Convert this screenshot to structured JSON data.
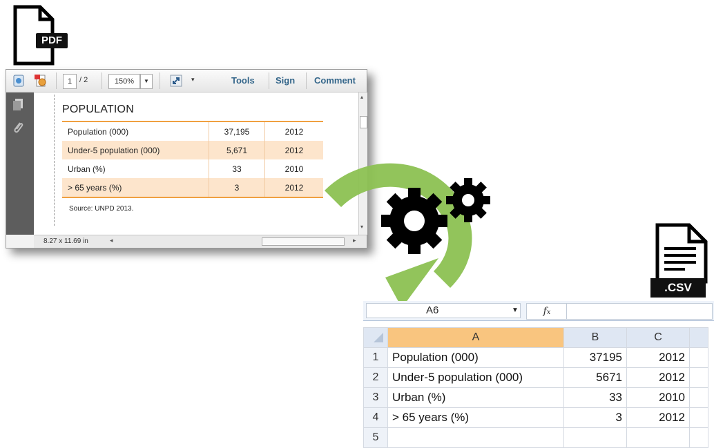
{
  "pdf_icon": {
    "badge": "PDF"
  },
  "pdf_viewer": {
    "toolbar": {
      "page_current": "1",
      "page_total": "/ 2",
      "zoom": "150%",
      "tools": "Tools",
      "sign": "Sign",
      "comment": "Comment"
    },
    "content": {
      "title": "POPULATION",
      "rows": [
        [
          "Population (000)",
          "37,195",
          "2012"
        ],
        [
          "Under-5 population (000)",
          "5,671",
          "2012"
        ],
        [
          "Urban (%)",
          "33",
          "2010"
        ],
        [
          "> 65 years (%)",
          "3",
          "2012"
        ]
      ],
      "source": "Source: UNPD 2013."
    },
    "status": {
      "page_size": "8.27 x 11.69 in"
    }
  },
  "csv_icon": {
    "badge": ".CSV"
  },
  "spreadsheet": {
    "name_box": "A6",
    "fx": "fx",
    "columns": [
      "A",
      "B",
      "C"
    ],
    "rows": [
      {
        "num": "1",
        "a": "Population (000)",
        "b": "37195",
        "c": "2012"
      },
      {
        "num": "2",
        "a": "Under-5 population (000)",
        "b": "5671",
        "c": "2012"
      },
      {
        "num": "3",
        "a": "Urban (%)",
        "b": "33",
        "c": "2010"
      },
      {
        "num": "4",
        "a": "> 65 years (%)",
        "b": "3",
        "c": "2012"
      },
      {
        "num": "5",
        "a": "",
        "b": "",
        "c": ""
      }
    ]
  },
  "colors": {
    "arrow": "#8cc152",
    "gear": "#000000",
    "table_shade": "#fde5cc",
    "table_rule": "#f0a040",
    "selected_col": "#f9c57f"
  }
}
